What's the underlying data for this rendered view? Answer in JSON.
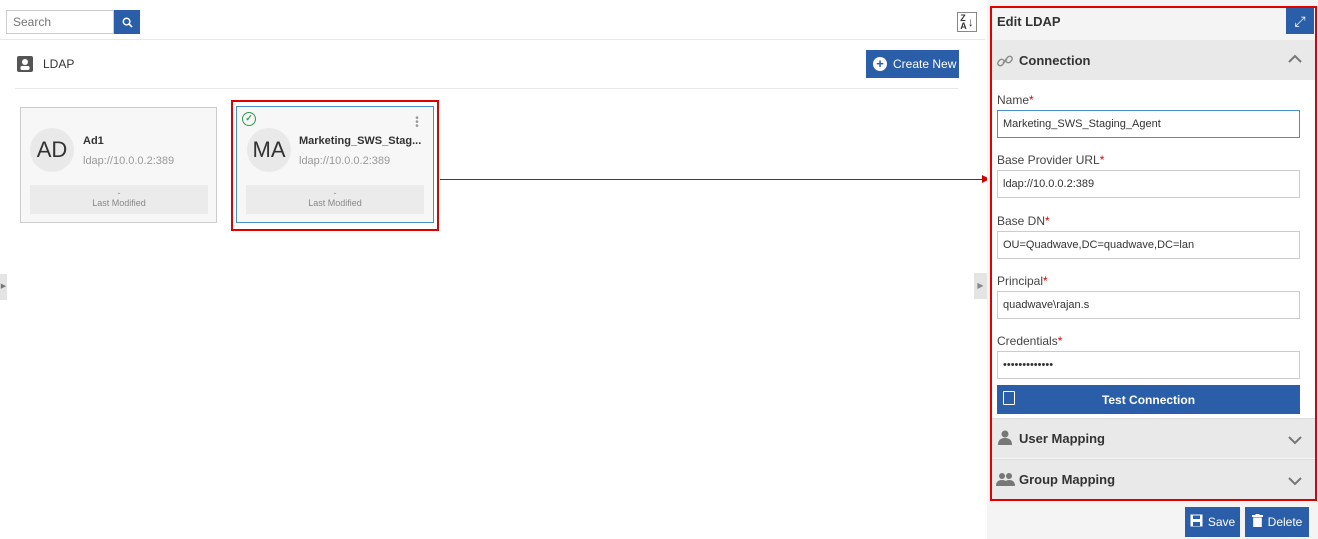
{
  "toolbar": {
    "search_placeholder": "Search",
    "search_icon": "search-icon",
    "sort_icon": "sort-az-icon",
    "sort_glyph_top": "Z",
    "sort_glyph_bottom": "A"
  },
  "section": {
    "title": "LDAP",
    "create_label": "Create New",
    "create_glyph": "+"
  },
  "cards": [
    {
      "initials": "AD",
      "name": "Ad1",
      "url": "ldap://10.0.0.2:389",
      "modified_value": "-",
      "modified_label": "Last Modified",
      "selected": false
    },
    {
      "initials": "MA",
      "name": "Marketing_SWS_Stag...",
      "url": "ldap://10.0.0.2:389",
      "modified_value": "-",
      "modified_label": "Last Modified",
      "selected": true
    }
  ],
  "glyphs": {
    "check": "✓",
    "kebab": "⋮",
    "collapse_left": "▶",
    "collapse_mid": "▶",
    "expand": "⤢",
    "link": "🔗",
    "chevron_up": "︿",
    "chevron_down": "﹀",
    "user": "👤",
    "group": "👥",
    "required": "*"
  },
  "panel": {
    "title": "Edit LDAP",
    "connection": {
      "title": "Connection",
      "fields": {
        "name_label": "Name",
        "name_value": "Marketing_SWS_Staging_Agent",
        "url_label": "Base Provider URL",
        "url_value": "ldap://10.0.0.2:389",
        "dn_label": "Base DN",
        "dn_value": "OU=Quadwave,DC=quadwave,DC=lan",
        "principal_label": "Principal",
        "principal_value": "quadwave\\rajan.s",
        "credentials_label": "Credentials",
        "credentials_value": "•••••••••••••"
      },
      "test_label": "Test Connection"
    },
    "user_mapping": "User Mapping",
    "group_mapping": "Group Mapping",
    "save_label": "Save",
    "delete_label": "Delete"
  },
  "colors": {
    "accent": "#2a5ea8",
    "highlight": "#e00000",
    "success": "#2e9a4e"
  }
}
